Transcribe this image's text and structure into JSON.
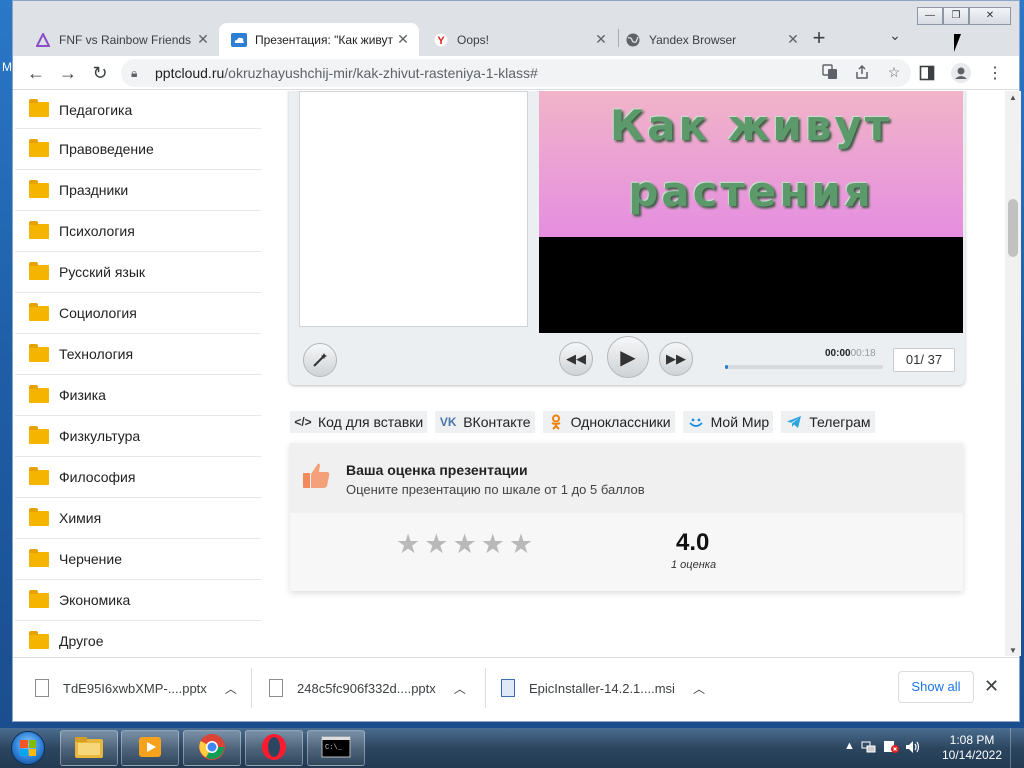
{
  "desktop": {
    "edge_letter": "M"
  },
  "tabs": [
    {
      "title": "FNF vs Rainbow Friends",
      "icon": "triangle-icon",
      "color": "#8a4fc9"
    },
    {
      "title": "Презентация: \"Как живут растения\"",
      "icon": "cloud-icon",
      "color": "#2d7fd3"
    },
    {
      "title": "Oops!",
      "icon": "yandex-icon",
      "color": "#e8201b"
    },
    {
      "title": "Yandex Browser",
      "icon": "globe-icon",
      "color": "#5f6368"
    }
  ],
  "window": {
    "minimize": "—",
    "restore": "❐",
    "close": "✕"
  },
  "toolbar": {
    "url_domain": "pptcloud.ru",
    "url_path": "/okruzhayushchij-mir/kak-zhivut-rasteniya-1-klass#"
  },
  "sidebar": {
    "categories": [
      "Педагогика",
      "Правоведение",
      "Праздники",
      "Психология",
      "Русский язык",
      "Социология",
      "Технология",
      "Физика",
      "Физкультура",
      "Философия",
      "Химия",
      "Черчение",
      "Экономика",
      "Другое"
    ]
  },
  "player": {
    "slide_title_line1": "Как живут",
    "slide_title_line2": "растения",
    "time_current": "00:00",
    "time_total": "00:18",
    "counter": "01/ 37",
    "progress": 0.01
  },
  "share": [
    {
      "label": "Код для вставки",
      "icon": "code-icon",
      "color": "#333333"
    },
    {
      "label": "ВКонтакте",
      "icon": "vk-icon",
      "color": "#4a76a8"
    },
    {
      "label": "Одноклассники",
      "icon": "ok-icon",
      "color": "#ee8208"
    },
    {
      "label": "Мой Мир",
      "icon": "mymir-icon",
      "color": "#168de2"
    },
    {
      "label": "Телеграм",
      "icon": "telegram-icon",
      "color": "#2ca5e0"
    }
  ],
  "rating": {
    "title": "Ваша оценка презентации",
    "subtitle": "Оцените презентацию по шкале от 1 до 5 баллов",
    "score": "4.0",
    "votes": "1 оценка",
    "stars_max": 5
  },
  "downloads": [
    {
      "name": "TdE95I6xwbXMP-....pptx"
    },
    {
      "name": "248c5fc906f332d....pptx"
    },
    {
      "name": "EpicInstaller-14.2.1....msi"
    }
  ],
  "download_bar": {
    "show_all": "Show all"
  },
  "taskbar": {
    "time": "1:08 PM",
    "date": "10/14/2022"
  }
}
